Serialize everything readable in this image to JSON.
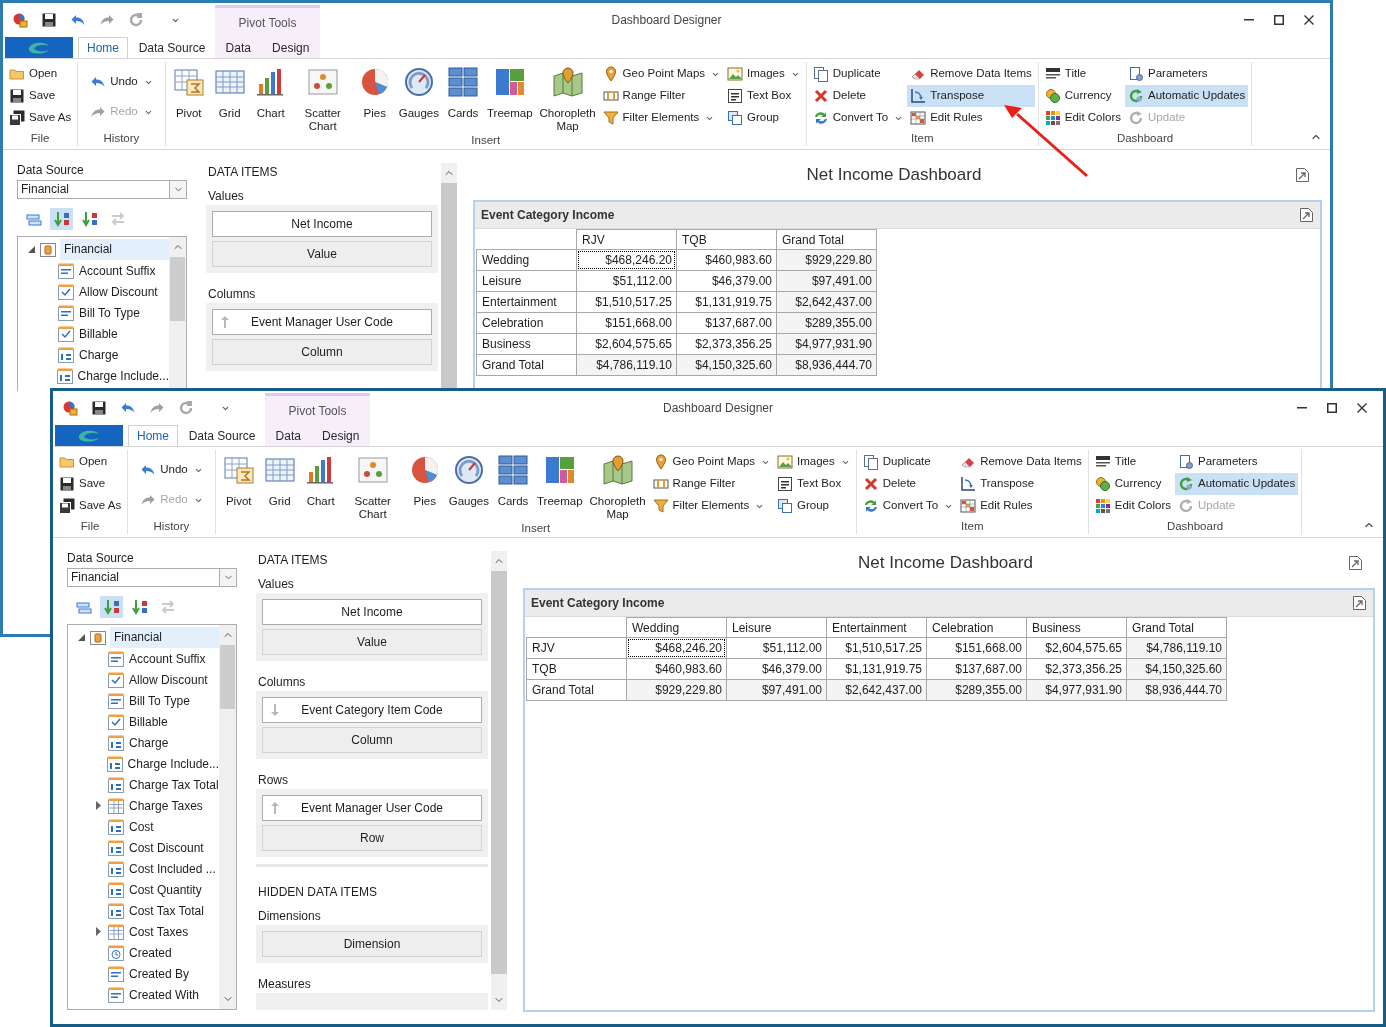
{
  "windows": [
    {
      "title": "Dashboard Designer",
      "contextual_group": "Pivot Tools",
      "tabs": [
        {
          "label": "Home",
          "selected": true
        },
        {
          "label": "Data Source",
          "selected": false
        },
        {
          "label": "Data",
          "selected": false
        },
        {
          "label": "Design",
          "selected": false
        }
      ],
      "ribbon": [
        {
          "label": "File",
          "columns": [
            [
              {
                "label": "Open",
                "selected": false,
                "disabled": false,
                "dropdown": false
              },
              {
                "label": "Save",
                "selected": false,
                "disabled": false,
                "dropdown": false
              },
              {
                "label": "Save As",
                "selected": false,
                "disabled": false,
                "dropdown": false
              }
            ]
          ]
        },
        {
          "label": "History",
          "columns": [
            [
              {
                "label": "Undo",
                "selected": false,
                "disabled": false,
                "dropdown": true
              },
              {
                "label": "Redo",
                "selected": false,
                "disabled": true,
                "dropdown": true
              }
            ]
          ]
        },
        {
          "label": "Insert",
          "large": [
            {
              "label": "Pivot"
            },
            {
              "label": "Grid"
            },
            {
              "label": "Chart"
            },
            {
              "label": "Scatter Chart"
            },
            {
              "label": "Pies"
            },
            {
              "label": "Gauges"
            },
            {
              "label": "Cards"
            },
            {
              "label": "Treemap"
            },
            {
              "label": "Choropleth Map"
            }
          ],
          "columns": [
            [
              {
                "label": "Geo Point Maps",
                "selected": false,
                "disabled": false,
                "dropdown": true
              },
              {
                "label": "Range Filter",
                "selected": false,
                "disabled": false,
                "dropdown": false
              },
              {
                "label": "Filter Elements",
                "selected": false,
                "disabled": false,
                "dropdown": true
              }
            ],
            [
              {
                "label": "Images",
                "selected": false,
                "disabled": false,
                "dropdown": true
              },
              {
                "label": "Text Box",
                "selected": false,
                "disabled": false,
                "dropdown": false
              },
              {
                "label": "Group",
                "selected": false,
                "disabled": false,
                "dropdown": false
              }
            ]
          ]
        },
        {
          "label": "Item",
          "columns": [
            [
              {
                "label": "Duplicate",
                "selected": false,
                "disabled": false,
                "dropdown": false
              },
              {
                "label": "Delete",
                "selected": false,
                "disabled": false,
                "dropdown": false
              },
              {
                "label": "Convert To",
                "selected": false,
                "disabled": false,
                "dropdown": true
              }
            ],
            [
              {
                "label": "Remove Data Items",
                "selected": false,
                "disabled": false,
                "dropdown": false
              },
              {
                "label": "Transpose",
                "selected": true,
                "disabled": false,
                "dropdown": false
              },
              {
                "label": "Edit Rules",
                "selected": false,
                "disabled": false,
                "dropdown": false
              }
            ]
          ]
        },
        {
          "label": "Dashboard",
          "columns": [
            [
              {
                "label": "Title",
                "selected": false,
                "disabled": false,
                "dropdown": false
              },
              {
                "label": "Currency",
                "selected": false,
                "disabled": false,
                "dropdown": false
              },
              {
                "label": "Edit Colors",
                "selected": false,
                "disabled": false,
                "dropdown": false
              }
            ],
            [
              {
                "label": "Parameters",
                "selected": false,
                "disabled": false,
                "dropdown": false
              },
              {
                "label": "Automatic Updates",
                "selected": true,
                "disabled": false,
                "dropdown": false
              },
              {
                "label": "Update",
                "selected": false,
                "disabled": true,
                "dropdown": false
              }
            ]
          ]
        }
      ],
      "field_list": {
        "label": "Data Source",
        "value": "Financial",
        "toolbar": [
          {
            "selected": false,
            "disabled": false
          },
          {
            "selected": true,
            "disabled": false
          },
          {
            "selected": false,
            "disabled": false
          },
          {
            "selected": false,
            "disabled": true
          }
        ],
        "tree": {
          "label": "Financial",
          "expanded": true,
          "selected": true,
          "children": [
            {
              "label": "Account Suffix",
              "kind": "text"
            },
            {
              "label": "Allow Discount",
              "kind": "bool"
            },
            {
              "label": "Bill To Type",
              "kind": "text"
            },
            {
              "label": "Billable",
              "kind": "bool"
            },
            {
              "label": "Charge",
              "kind": "number"
            },
            {
              "label": "Charge Include...",
              "kind": "number"
            }
          ]
        }
      },
      "data_items": [
        {
          "kind": "heading",
          "label": "DATA ITEMS"
        },
        {
          "kind": "group",
          "label": "Values",
          "items": [
            {
              "label": "Net Income",
              "kind": "field"
            },
            {
              "label": "Value",
              "kind": "placeholder"
            }
          ]
        },
        {
          "kind": "group",
          "label": "Columns",
          "items": [
            {
              "label": "Event Manager User Code",
              "kind": "field",
              "descending": false
            },
            {
              "label": "Column",
              "kind": "placeholder"
            }
          ]
        }
      ],
      "dashboard": {
        "title": "Net Income Dashboard",
        "item": {
          "caption": "Event Category Income",
          "columns": [
            "RJV",
            "TQB",
            "Grand Total"
          ],
          "rows": [
            {
              "label": "Wedding",
              "cells": [
                {
                  "text": "$468,246.20",
                  "focused": true
                },
                {
                  "text": "$460,983.60",
                  "focused": false
                },
                {
                  "text": "$929,229.80",
                  "focused": false
                }
              ]
            },
            {
              "label": "Leisure",
              "cells": [
                {
                  "text": "$51,112.00",
                  "focused": false
                },
                {
                  "text": "$46,379.00",
                  "focused": false
                },
                {
                  "text": "$97,491.00",
                  "focused": false
                }
              ]
            },
            {
              "label": "Entertainment",
              "cells": [
                {
                  "text": "$1,510,517.25",
                  "focused": false
                },
                {
                  "text": "$1,131,919.75",
                  "focused": false
                },
                {
                  "text": "$2,642,437.00",
                  "focused": false
                }
              ]
            },
            {
              "label": "Celebration",
              "cells": [
                {
                  "text": "$151,668.00",
                  "focused": false
                },
                {
                  "text": "$137,687.00",
                  "focused": false
                },
                {
                  "text": "$289,355.00",
                  "focused": false
                }
              ]
            },
            {
              "label": "Business",
              "cells": [
                {
                  "text": "$2,604,575.65",
                  "focused": false
                },
                {
                  "text": "$2,373,356.25",
                  "focused": false
                },
                {
                  "text": "$4,977,931.90",
                  "focused": false
                }
              ]
            },
            {
              "label": "Grand Total",
              "cells": [
                {
                  "text": "$4,786,119.10",
                  "focused": false
                },
                {
                  "text": "$4,150,325.60",
                  "focused": false
                },
                {
                  "text": "$8,936,444.70",
                  "focused": false
                }
              ]
            }
          ]
        }
      }
    },
    {
      "title": "Dashboard Designer",
      "contextual_group": "Pivot Tools",
      "tabs": [
        {
          "label": "Home",
          "selected": true
        },
        {
          "label": "Data Source",
          "selected": false
        },
        {
          "label": "Data",
          "selected": false
        },
        {
          "label": "Design",
          "selected": false
        }
      ],
      "ribbon": [
        {
          "label": "File",
          "columns": [
            [
              {
                "label": "Open",
                "selected": false,
                "disabled": false,
                "dropdown": false
              },
              {
                "label": "Save",
                "selected": false,
                "disabled": false,
                "dropdown": false
              },
              {
                "label": "Save As",
                "selected": false,
                "disabled": false,
                "dropdown": false
              }
            ]
          ]
        },
        {
          "label": "History",
          "columns": [
            [
              {
                "label": "Undo",
                "selected": false,
                "disabled": false,
                "dropdown": true
              },
              {
                "label": "Redo",
                "selected": false,
                "disabled": true,
                "dropdown": true
              }
            ]
          ]
        },
        {
          "label": "Insert",
          "large": [
            {
              "label": "Pivot"
            },
            {
              "label": "Grid"
            },
            {
              "label": "Chart"
            },
            {
              "label": "Scatter Chart"
            },
            {
              "label": "Pies"
            },
            {
              "label": "Gauges"
            },
            {
              "label": "Cards"
            },
            {
              "label": "Treemap"
            },
            {
              "label": "Choropleth Map"
            }
          ],
          "columns": [
            [
              {
                "label": "Geo Point Maps",
                "selected": false,
                "disabled": false,
                "dropdown": true
              },
              {
                "label": "Range Filter",
                "selected": false,
                "disabled": false,
                "dropdown": false
              },
              {
                "label": "Filter Elements",
                "selected": false,
                "disabled": false,
                "dropdown": true
              }
            ],
            [
              {
                "label": "Images",
                "selected": false,
                "disabled": false,
                "dropdown": true
              },
              {
                "label": "Text Box",
                "selected": false,
                "disabled": false,
                "dropdown": false
              },
              {
                "label": "Group",
                "selected": false,
                "disabled": false,
                "dropdown": false
              }
            ]
          ]
        },
        {
          "label": "Item",
          "columns": [
            [
              {
                "label": "Duplicate",
                "selected": false,
                "disabled": false,
                "dropdown": false
              },
              {
                "label": "Delete",
                "selected": false,
                "disabled": false,
                "dropdown": false
              },
              {
                "label": "Convert To",
                "selected": false,
                "disabled": false,
                "dropdown": true
              }
            ],
            [
              {
                "label": "Remove Data Items",
                "selected": false,
                "disabled": false,
                "dropdown": false
              },
              {
                "label": "Transpose",
                "selected": false,
                "disabled": false,
                "dropdown": false
              },
              {
                "label": "Edit Rules",
                "selected": false,
                "disabled": false,
                "dropdown": false
              }
            ]
          ]
        },
        {
          "label": "Dashboard",
          "columns": [
            [
              {
                "label": "Title",
                "selected": false,
                "disabled": false,
                "dropdown": false
              },
              {
                "label": "Currency",
                "selected": false,
                "disabled": false,
                "dropdown": false
              },
              {
                "label": "Edit Colors",
                "selected": false,
                "disabled": false,
                "dropdown": false
              }
            ],
            [
              {
                "label": "Parameters",
                "selected": false,
                "disabled": false,
                "dropdown": false
              },
              {
                "label": "Automatic Updates",
                "selected": true,
                "disabled": false,
                "dropdown": false
              },
              {
                "label": "Update",
                "selected": false,
                "disabled": true,
                "dropdown": false
              }
            ]
          ]
        }
      ],
      "field_list": {
        "label": "Data Source",
        "value": "Financial",
        "toolbar": [
          {
            "selected": false,
            "disabled": false
          },
          {
            "selected": true,
            "disabled": false
          },
          {
            "selected": false,
            "disabled": false
          },
          {
            "selected": false,
            "disabled": true
          }
        ],
        "tree": {
          "label": "Financial",
          "expanded": true,
          "selected": true,
          "children": [
            {
              "label": "Account Suffix",
              "kind": "text"
            },
            {
              "label": "Allow Discount",
              "kind": "bool"
            },
            {
              "label": "Bill To Type",
              "kind": "text"
            },
            {
              "label": "Billable",
              "kind": "bool"
            },
            {
              "label": "Charge",
              "kind": "number"
            },
            {
              "label": "Charge Include...",
              "kind": "number"
            },
            {
              "label": "Charge Tax Total",
              "kind": "number"
            },
            {
              "label": "Charge Taxes",
              "kind": "table",
              "expanded": false
            },
            {
              "label": "Cost",
              "kind": "number"
            },
            {
              "label": "Cost Discount",
              "kind": "number"
            },
            {
              "label": "Cost Included ...",
              "kind": "number"
            },
            {
              "label": "Cost Quantity",
              "kind": "number"
            },
            {
              "label": "Cost Tax Total",
              "kind": "number"
            },
            {
              "label": "Cost Taxes",
              "kind": "table",
              "expanded": false
            },
            {
              "label": "Created",
              "kind": "date"
            },
            {
              "label": "Created By",
              "kind": "text"
            },
            {
              "label": "Created With",
              "kind": "text"
            }
          ]
        }
      },
      "data_items": [
        {
          "kind": "heading",
          "label": "DATA ITEMS"
        },
        {
          "kind": "group",
          "label": "Values",
          "items": [
            {
              "label": "Net Income",
              "kind": "field"
            },
            {
              "label": "Value",
              "kind": "placeholder"
            }
          ]
        },
        {
          "kind": "group",
          "label": "Columns",
          "items": [
            {
              "label": "Event Category Item Code",
              "kind": "field",
              "descending": true
            },
            {
              "label": "Column",
              "kind": "placeholder"
            }
          ]
        },
        {
          "kind": "group",
          "label": "Rows",
          "items": [
            {
              "label": "Event Manager User Code",
              "kind": "field",
              "descending": false
            },
            {
              "label": "Row",
              "kind": "placeholder"
            }
          ]
        },
        {
          "kind": "heading",
          "label": "HIDDEN DATA ITEMS"
        },
        {
          "kind": "group",
          "label": "Dimensions",
          "items": [
            {
              "label": "Dimension",
              "kind": "placeholder"
            }
          ]
        },
        {
          "kind": "group",
          "label": "Measures"
        }
      ],
      "dashboard": {
        "title": "Net Income Dashboard",
        "item": {
          "caption": "Event Category Income",
          "columns": [
            "Wedding",
            "Leisure",
            "Entertainment",
            "Celebration",
            "Business",
            "Grand Total"
          ],
          "rows": [
            {
              "label": "RJV",
              "cells": [
                {
                  "text": "$468,246.20",
                  "focused": true
                },
                {
                  "text": "$51,112.00",
                  "focused": false
                },
                {
                  "text": "$1,510,517.25",
                  "focused": false
                },
                {
                  "text": "$151,668.00",
                  "focused": false
                },
                {
                  "text": "$2,604,575.65",
                  "focused": false
                },
                {
                  "text": "$4,786,119.10",
                  "focused": false
                }
              ]
            },
            {
              "label": "TQB",
              "cells": [
                {
                  "text": "$460,983.60",
                  "focused": false
                },
                {
                  "text": "$46,379.00",
                  "focused": false
                },
                {
                  "text": "$1,131,919.75",
                  "focused": false
                },
                {
                  "text": "$137,687.00",
                  "focused": false
                },
                {
                  "text": "$2,373,356.25",
                  "focused": false
                },
                {
                  "text": "$4,150,325.60",
                  "focused": false
                }
              ]
            },
            {
              "label": "Grand Total",
              "cells": [
                {
                  "text": "$929,229.80",
                  "focused": false
                },
                {
                  "text": "$97,491.00",
                  "focused": false
                },
                {
                  "text": "$2,642,437.00",
                  "focused": false
                },
                {
                  "text": "$289,355.00",
                  "focused": false
                },
                {
                  "text": "$4,977,931.90",
                  "focused": false
                },
                {
                  "text": "$8,936,444.70",
                  "focused": false
                }
              ]
            }
          ]
        }
      }
    }
  ]
}
